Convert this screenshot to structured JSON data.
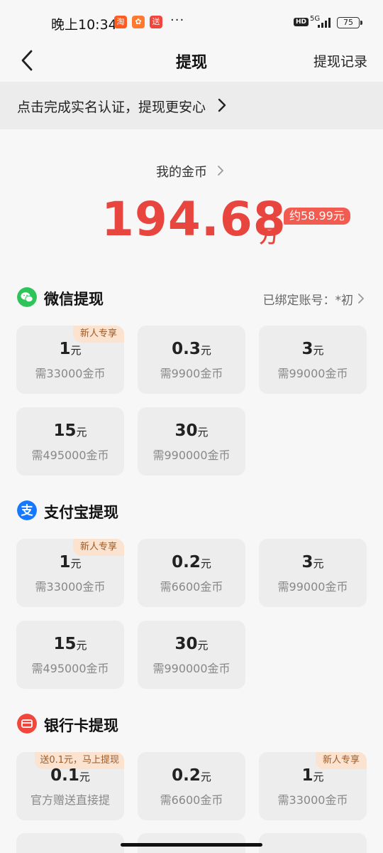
{
  "status_bar": {
    "time": "晚上10:34",
    "apps": [
      {
        "glyph": "淘",
        "color": "#ff5a1f"
      },
      {
        "glyph": "✿",
        "color": "#ff7a2e"
      },
      {
        "glyph": "送",
        "color": "#f0463c"
      }
    ],
    "more": "···",
    "hd": "HD",
    "network": "5G",
    "battery": "75"
  },
  "nav": {
    "title": "提现",
    "right_link": "提现记录"
  },
  "banner": {
    "text": "点击完成实名认证，提现更安心"
  },
  "coins": {
    "label": "我的金币",
    "amount": "194.68",
    "unit": "万",
    "approx": "约58.99元"
  },
  "sections": [
    {
      "title": "微信提现",
      "bind_text": "已绑定账号：*初",
      "icon": "wechat-icon",
      "icon_color": "#2ec45a",
      "cards": [
        {
          "amount": "1",
          "yuan": "元",
          "need": "需33000金币",
          "tag": "新人专享"
        },
        {
          "amount": "0.3",
          "yuan": "元",
          "need": "需9900金币",
          "tag": ""
        },
        {
          "amount": "3",
          "yuan": "元",
          "need": "需99000金币",
          "tag": ""
        },
        {
          "amount": "15",
          "yuan": "元",
          "need": "需495000金币",
          "tag": ""
        },
        {
          "amount": "30",
          "yuan": "元",
          "need": "需990000金币",
          "tag": ""
        }
      ]
    },
    {
      "title": "支付宝提现",
      "bind_text": "",
      "icon": "alipay-icon",
      "icon_color": "#1677ff",
      "cards": [
        {
          "amount": "1",
          "yuan": "元",
          "need": "需33000金币",
          "tag": "新人专享"
        },
        {
          "amount": "0.2",
          "yuan": "元",
          "need": "需6600金币",
          "tag": ""
        },
        {
          "amount": "3",
          "yuan": "元",
          "need": "需99000金币",
          "tag": ""
        },
        {
          "amount": "15",
          "yuan": "元",
          "need": "需495000金币",
          "tag": ""
        },
        {
          "amount": "30",
          "yuan": "元",
          "need": "需990000金币",
          "tag": ""
        }
      ]
    },
    {
      "title": "银行卡提现",
      "bind_text": "",
      "icon": "bank-card-icon",
      "icon_color": "#f0463c",
      "cards": [
        {
          "amount": "0.1",
          "yuan": "元",
          "need": "官方赠送直接提",
          "tag": "送0.1元，马上提现"
        },
        {
          "amount": "0.2",
          "yuan": "元",
          "need": "需6600金币",
          "tag": ""
        },
        {
          "amount": "1",
          "yuan": "元",
          "need": "需33000金币",
          "tag": "新人专享"
        }
      ]
    }
  ],
  "colors": {
    "accent_red": "#e8453f",
    "tag_bg": "#fbe3cf",
    "tag_text": "#9a5a2a",
    "card_bg": "#ededed"
  }
}
